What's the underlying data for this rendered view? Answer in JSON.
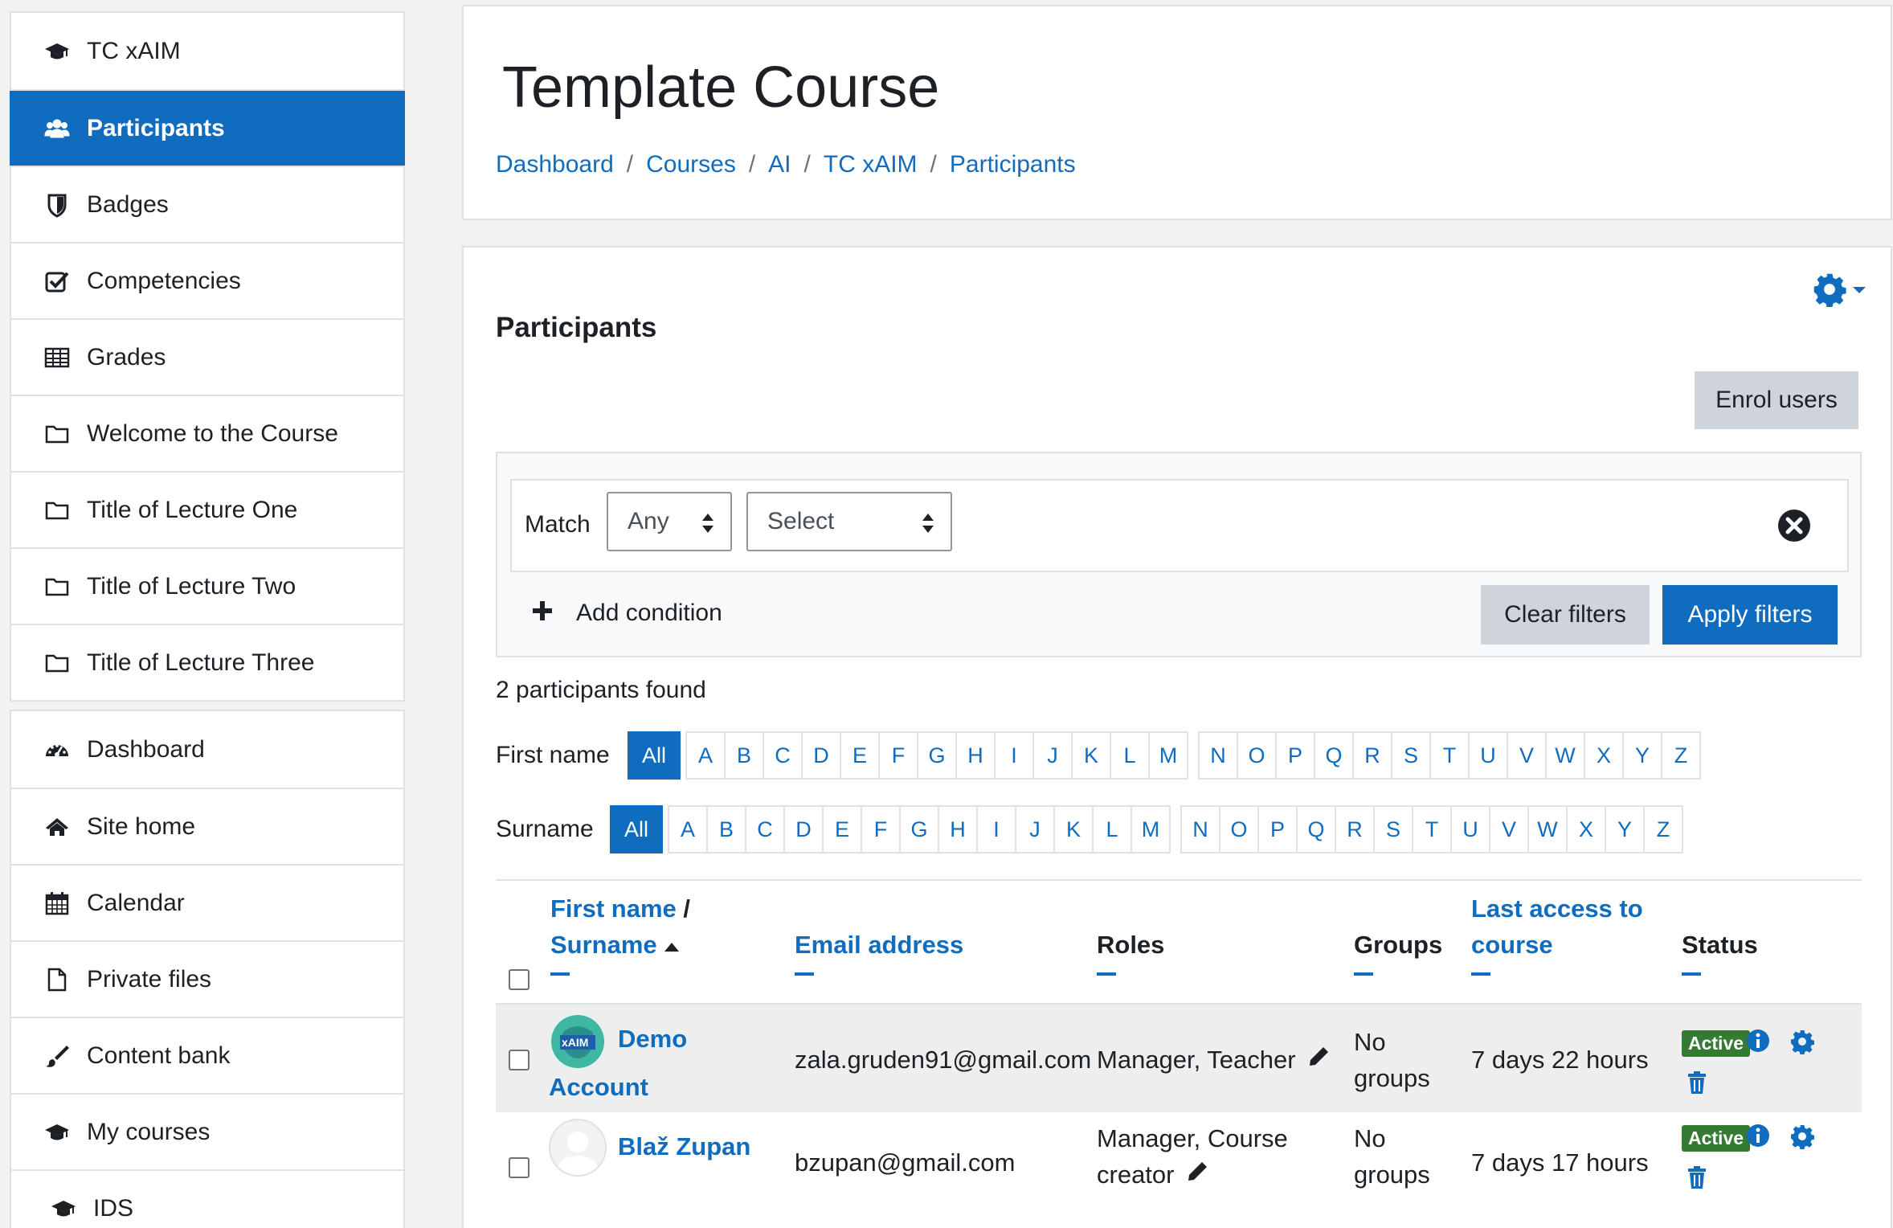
{
  "sidebar": {
    "course_items": [
      {
        "label": "TC xAIM",
        "icon": "graduation-cap-icon"
      },
      {
        "label": "Participants",
        "icon": "users-icon",
        "active": true
      },
      {
        "label": "Badges",
        "icon": "shield-icon"
      },
      {
        "label": "Competencies",
        "icon": "check-square-icon"
      },
      {
        "label": "Grades",
        "icon": "table-icon"
      },
      {
        "label": "Welcome to the Course",
        "icon": "folder-icon"
      },
      {
        "label": "Title of Lecture One",
        "icon": "folder-icon"
      },
      {
        "label": "Title of Lecture Two",
        "icon": "folder-icon"
      },
      {
        "label": "Title of Lecture Three",
        "icon": "folder-icon"
      }
    ],
    "site_items": [
      {
        "label": "Dashboard",
        "icon": "dashboard-icon"
      },
      {
        "label": "Site home",
        "icon": "home-icon"
      },
      {
        "label": "Calendar",
        "icon": "calendar-icon"
      },
      {
        "label": "Private files",
        "icon": "file-icon"
      },
      {
        "label": "Content bank",
        "icon": "brush-icon"
      },
      {
        "label": "My courses",
        "icon": "graduation-cap-icon"
      },
      {
        "label": "IDS",
        "icon": "graduation-cap-icon"
      }
    ]
  },
  "header": {
    "title": "Template Course",
    "breadcrumb": [
      "Dashboard",
      "Courses",
      "AI",
      "TC xAIM",
      "Participants"
    ]
  },
  "main": {
    "section_title": "Participants",
    "enrol_label": "Enrol users",
    "filter": {
      "match_label": "Match",
      "match_value": "Any",
      "select_value": "Select",
      "add_condition": "Add condition",
      "clear_label": "Clear filters",
      "apply_label": "Apply filters"
    },
    "found_text": "2 participants found",
    "first_name_label": "First name",
    "surname_label": "Surname",
    "all_label": "All",
    "letters_a": [
      "A",
      "B",
      "C",
      "D",
      "E",
      "F",
      "G",
      "H",
      "I",
      "J",
      "K",
      "L",
      "M"
    ],
    "letters_b": [
      "N",
      "O",
      "P",
      "Q",
      "R",
      "S",
      "T",
      "U",
      "V",
      "W",
      "X",
      "Y",
      "Z"
    ],
    "columns": {
      "name_line1": "First name",
      "name_sep": " /",
      "name_line2": "Surname",
      "email": "Email address",
      "roles": "Roles",
      "groups": "Groups",
      "last_access_1": "Last access to",
      "last_access_2": "course",
      "status": "Status"
    },
    "rows": [
      {
        "name_1": "Demo",
        "name_2": "Account",
        "avatar_text": "xAIM",
        "email": "zala.gruden91@gmail.com",
        "roles_1": "Manager, Teacher",
        "roles_2": "",
        "groups_1": "No",
        "groups_2": "groups",
        "last_access": "7 days 22 hours",
        "status": "Active"
      },
      {
        "name_1": "Blaž Zupan",
        "name_2": "",
        "avatar_text": "",
        "email": "bzupan@gmail.com",
        "roles_1": "Manager, Course",
        "roles_2": "creator",
        "groups_1": "No",
        "groups_2": "groups",
        "last_access": "7 days 17 hours",
        "status": "Active"
      }
    ]
  },
  "colors": {
    "primary": "#0f6cbf",
    "active_badge": "#357a32",
    "secondary_btn": "#ced4da"
  }
}
